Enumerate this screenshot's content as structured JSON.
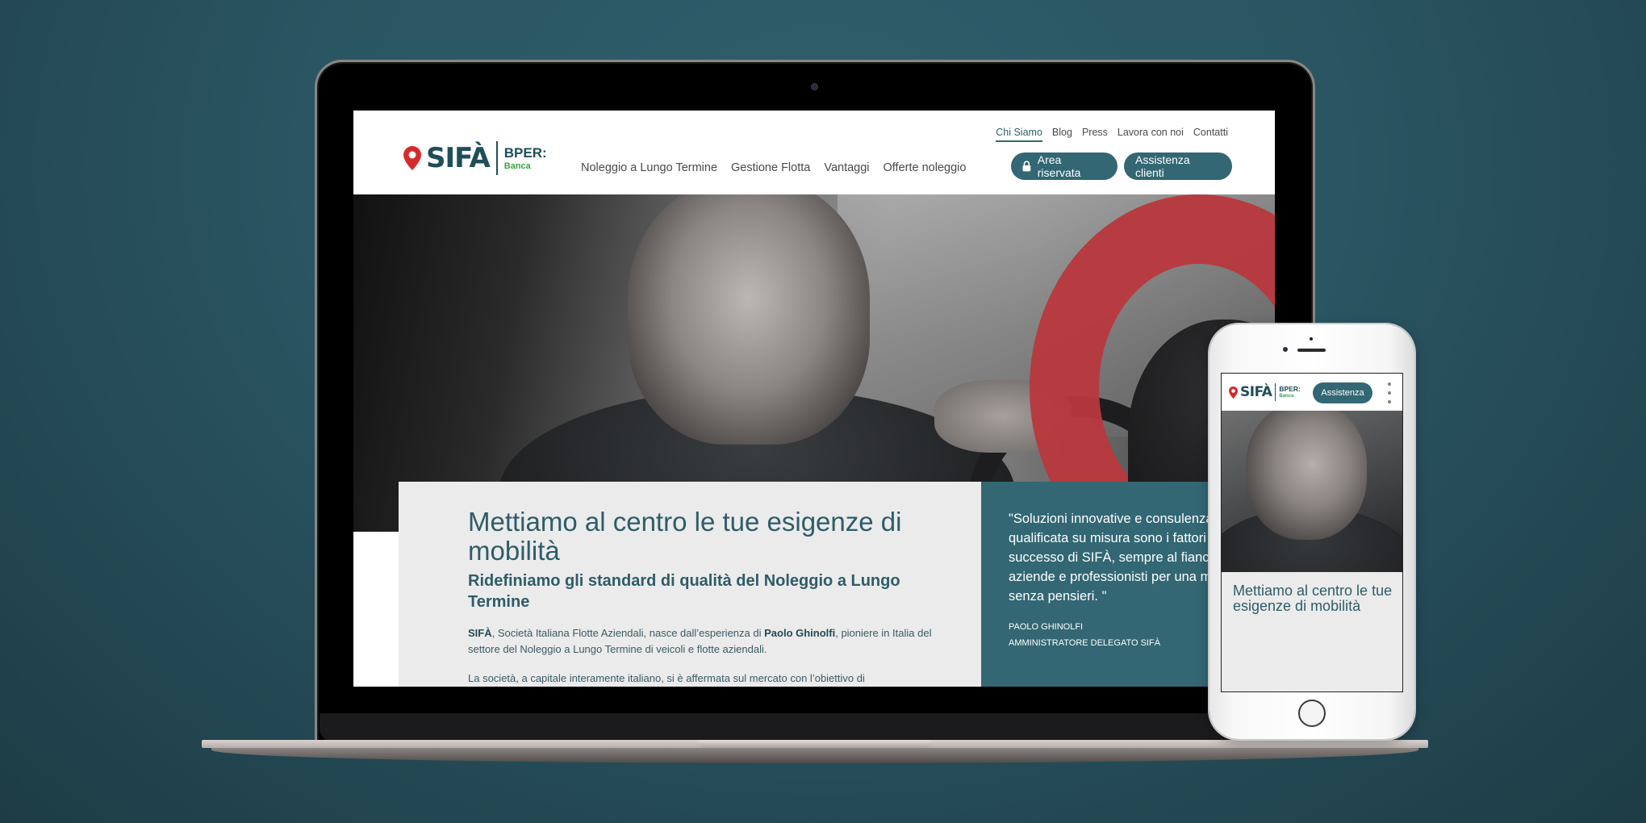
{
  "site": {
    "brand": {
      "name": "SIFÀ",
      "partner": "BPER:",
      "partner_sub": "Banca"
    },
    "top_links": [
      {
        "label": "Chi Siamo",
        "active": true
      },
      {
        "label": "Blog",
        "active": false
      },
      {
        "label": "Press",
        "active": false
      },
      {
        "label": "Lavora con noi",
        "active": false
      },
      {
        "label": "Contatti",
        "active": false
      }
    ],
    "main_nav": [
      {
        "label": "Noleggio a Lungo Termine"
      },
      {
        "label": "Gestione Flotta"
      },
      {
        "label": "Vantaggi"
      },
      {
        "label": "Offerte noleggio"
      }
    ],
    "buttons": {
      "area_riservata": "Area riservata",
      "assistenza_clienti": "Assistenza clienti"
    },
    "icons": {
      "brand": "map-pin-icon",
      "area": "lock-icon"
    },
    "hero": {
      "image_alt": "Man smiling at steering wheel of car",
      "accent_shape": "red map-pin ring"
    },
    "content": {
      "headline": "Mettiamo al centro le tue esigenze di mobilità",
      "subheadline": "Ridefiniamo gli standard di qualità del Noleggio a Lungo Termine",
      "paragraph1_strong1": "SIFÀ",
      "paragraph1_text1": ", Società Italiana Flotte Aziendali, nasce dall’esperienza di ",
      "paragraph1_strong2": "Paolo Ghinolfi",
      "paragraph1_text2": ", pioniere in Italia del settore del Noleggio a Lungo Termine di veicoli e flotte aziendali.",
      "paragraph2": "La società, a capitale interamente italiano, si è affermata sul mercato con l’obiettivo di"
    },
    "quote": {
      "text": "\"Soluzioni innovative e consulenza qualificata su misura sono i fattori di successo di SIFÀ, sempre al fianco di aziende e professionisti per una mobilità senza pensieri. \"",
      "author": "PAOLO GHINOLFI",
      "role": "AMMINISTRATORE DELEGATO SIFÀ"
    }
  },
  "mobile": {
    "button": "Assistenza",
    "menu_icon": "kebab-menu-icon",
    "headline": "Mettiamo al centro le tue esigenze di mobilità"
  },
  "colors": {
    "brand_teal": "#326773",
    "brand_dark": "#1f4e58",
    "brand_red": "#d62b2b",
    "brand_green": "#3aa14a",
    "accent_red": "#b8383d",
    "content_bg": "#ebebeb",
    "background": "#2a5562"
  }
}
